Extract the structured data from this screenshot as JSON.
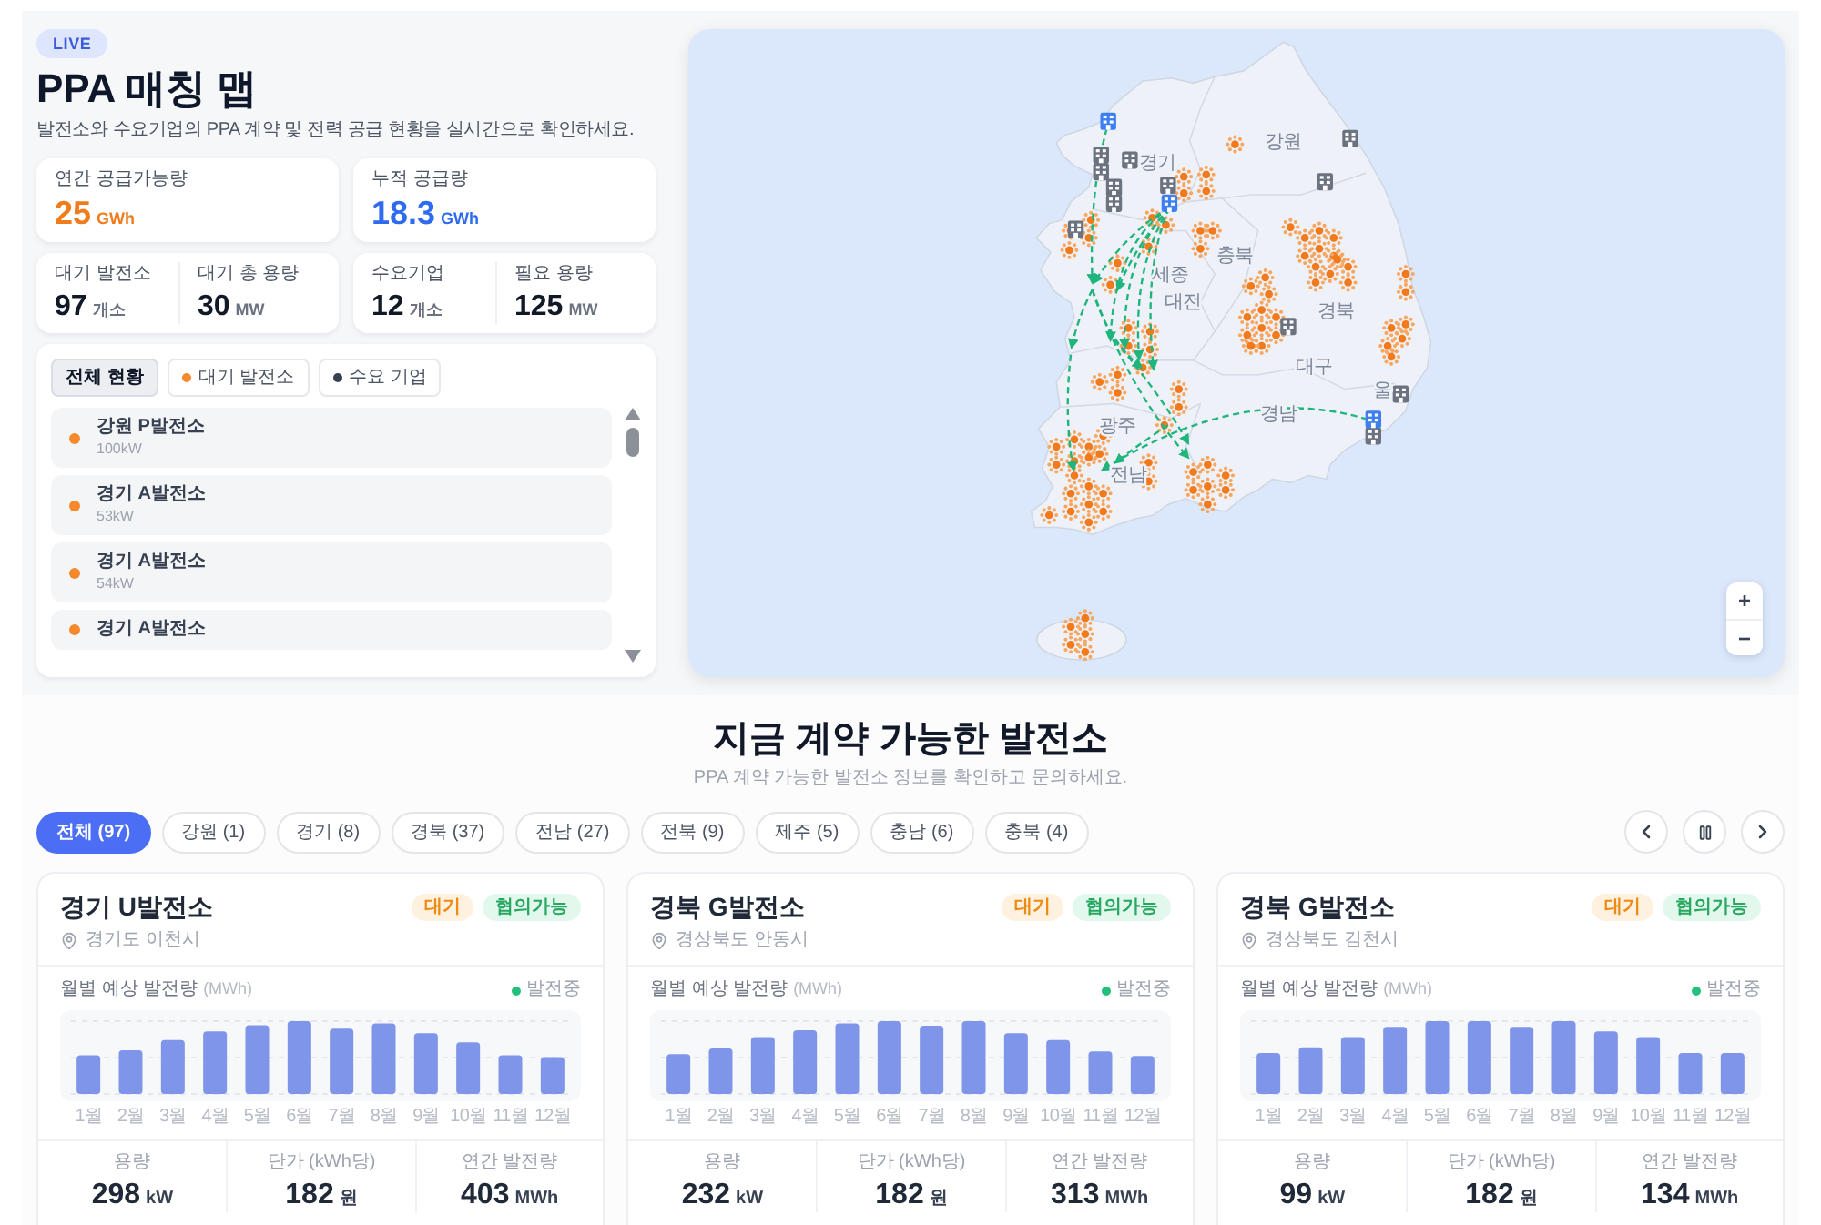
{
  "header": {
    "badge": "LIVE",
    "title": "PPA 매칭 맵",
    "subtitle": "발전소와 수요기업의 PPA 계약 및 전력 공급 현황을 실시간으로 확인하세요."
  },
  "summary": [
    {
      "label": "연간 공급가능량",
      "value": "25",
      "unit": "GWh",
      "color": "#f07c1c"
    },
    {
      "label": "누적 공급량",
      "value": "18.3",
      "unit": "GWh",
      "color": "#2f6bf0"
    }
  ],
  "stats": [
    {
      "items": [
        {
          "label": "대기 발전소",
          "value": "97",
          "unit": "개소"
        },
        {
          "label": "대기 총 용량",
          "value": "30",
          "unit": "MW"
        }
      ]
    },
    {
      "items": [
        {
          "label": "수요기업",
          "value": "12",
          "unit": "개소"
        },
        {
          "label": "필요 용량",
          "value": "125",
          "unit": "MW"
        }
      ]
    }
  ],
  "list_panel": {
    "tabs": [
      {
        "label": "전체 현황",
        "selected": true
      },
      {
        "label": "대기 발전소",
        "selected": false,
        "color": "#f5892b"
      },
      {
        "label": "수요 기업",
        "selected": false,
        "color": "#374151"
      }
    ],
    "items": [
      {
        "name": "강원 P발전소",
        "capacity": "100kW"
      },
      {
        "name": "경기 A발전소",
        "capacity": "53kW"
      },
      {
        "name": "경기 A발전소",
        "capacity": "54kW"
      },
      {
        "name": "경기 A발전소"
      }
    ]
  },
  "map": {
    "region_labels": [
      "강원",
      "경기",
      "충북",
      "세종",
      "대전",
      "경북",
      "대구",
      "경남",
      "광주",
      "전남",
      "울"
    ],
    "zoom_controls": [
      "+",
      "−"
    ]
  },
  "plants_section": {
    "title": "지금 계약 가능한 발전소",
    "subtitle": "PPA 계약 가능한 발전소 정보를 확인하고 문의하세요.",
    "filters": [
      {
        "label": "전체 (97)",
        "selected": true
      },
      {
        "label": "강원 (1)",
        "selected": false
      },
      {
        "label": "경기 (8)",
        "selected": false
      },
      {
        "label": "경북 (37)",
        "selected": false
      },
      {
        "label": "전남 (27)",
        "selected": false
      },
      {
        "label": "전북 (9)",
        "selected": false
      },
      {
        "label": "제주 (5)",
        "selected": false
      },
      {
        "label": "충남 (6)",
        "selected": false
      },
      {
        "label": "충북 (4)",
        "selected": false
      }
    ],
    "cards": [
      {
        "name": "경기 U발전소",
        "badges": [
          {
            "label": "대기",
            "kind": "status"
          },
          {
            "label": "협의가능",
            "kind": "deal"
          }
        ],
        "location": "경기도 이천시",
        "chart": {
          "title": "월별 예상 발전량",
          "unit": "(MWh)",
          "legend": "발전중",
          "months": [
            "1월",
            "2월",
            "3월",
            "4월",
            "5월",
            "6월",
            "7월",
            "8월",
            "9월",
            "10월",
            "11월",
            "12월"
          ]
        },
        "metrics": [
          {
            "label": "용량",
            "value": "298",
            "unit": "kW"
          },
          {
            "label": "단가 (kWh당)",
            "value": "182",
            "unit": "원"
          },
          {
            "label": "연간 발전량",
            "value": "403",
            "unit": "MWh"
          }
        ]
      },
      {
        "name": "경북 G발전소",
        "badges": [
          {
            "label": "대기",
            "kind": "status"
          },
          {
            "label": "협의가능",
            "kind": "deal"
          }
        ],
        "location": "경상북도 안동시",
        "chart": {
          "title": "월별 예상 발전량",
          "unit": "(MWh)",
          "legend": "발전중",
          "months": [
            "1월",
            "2월",
            "3월",
            "4월",
            "5월",
            "6월",
            "7월",
            "8월",
            "9월",
            "10월",
            "11월",
            "12월"
          ]
        },
        "metrics": [
          {
            "label": "용량",
            "value": "232",
            "unit": "kW"
          },
          {
            "label": "단가 (kWh당)",
            "value": "182",
            "unit": "원"
          },
          {
            "label": "연간 발전량",
            "value": "313",
            "unit": "MWh"
          }
        ]
      },
      {
        "name": "경북 G발전소",
        "badges": [
          {
            "label": "대기",
            "kind": "status"
          },
          {
            "label": "협의가능",
            "kind": "deal"
          }
        ],
        "location": "경상북도 김천시",
        "chart": {
          "title": "월별 예상 발전량",
          "unit": "(MWh)",
          "legend": "발전중",
          "months": [
            "1월",
            "2월",
            "3월",
            "4월",
            "5월",
            "6월",
            "7월",
            "8월",
            "9월",
            "10월",
            "11월",
            "12월"
          ]
        },
        "metrics": [
          {
            "label": "용량",
            "value": "99",
            "unit": "kW"
          },
          {
            "label": "단가 (kWh당)",
            "value": "182",
            "unit": "원"
          },
          {
            "label": "연간 발전량",
            "value": "134",
            "unit": "MWh"
          }
        ]
      }
    ]
  }
}
